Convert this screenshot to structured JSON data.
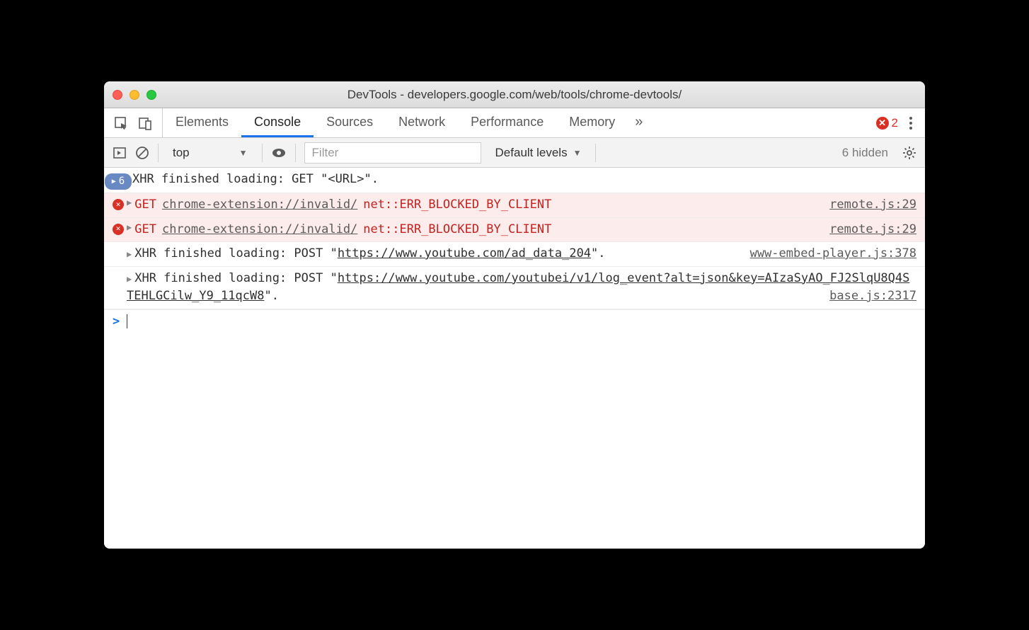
{
  "window": {
    "title": "DevTools - developers.google.com/web/tools/chrome-devtools/"
  },
  "tabs": {
    "items": [
      "Elements",
      "Console",
      "Sources",
      "Network",
      "Performance",
      "Memory"
    ],
    "active": "Console",
    "error_count": "2"
  },
  "toolbar": {
    "context": "top",
    "filter_placeholder": "Filter",
    "levels": "Default levels",
    "hidden_text": "6 hidden"
  },
  "console": {
    "rows": [
      {
        "type": "info",
        "count": "6",
        "text": "XHR finished loading: GET \"<URL>\"."
      },
      {
        "type": "error",
        "method": "GET",
        "url": "chrome-extension://invalid/",
        "error": "net::ERR_BLOCKED_BY_CLIENT",
        "source": "remote.js:29"
      },
      {
        "type": "error",
        "method": "GET",
        "url": "chrome-extension://invalid/",
        "error": "net::ERR_BLOCKED_BY_CLIENT",
        "source": "remote.js:29"
      },
      {
        "type": "plain",
        "prefix": "XHR finished loading: POST \"",
        "url": "https://www.youtube.com/ad_data_204",
        "suffix": "\".",
        "source": "www-embed-player.js:378"
      },
      {
        "type": "plain",
        "prefix": "XHR finished loading: POST \"",
        "url": "https://www.youtube.com/youtubei/v1/log_event?alt=json&key=AIzaSyAO_FJ2SlqU8Q4STEHLGCilw_Y9_11qcW8",
        "suffix": "\".",
        "source": "base.js:2317"
      }
    ]
  }
}
